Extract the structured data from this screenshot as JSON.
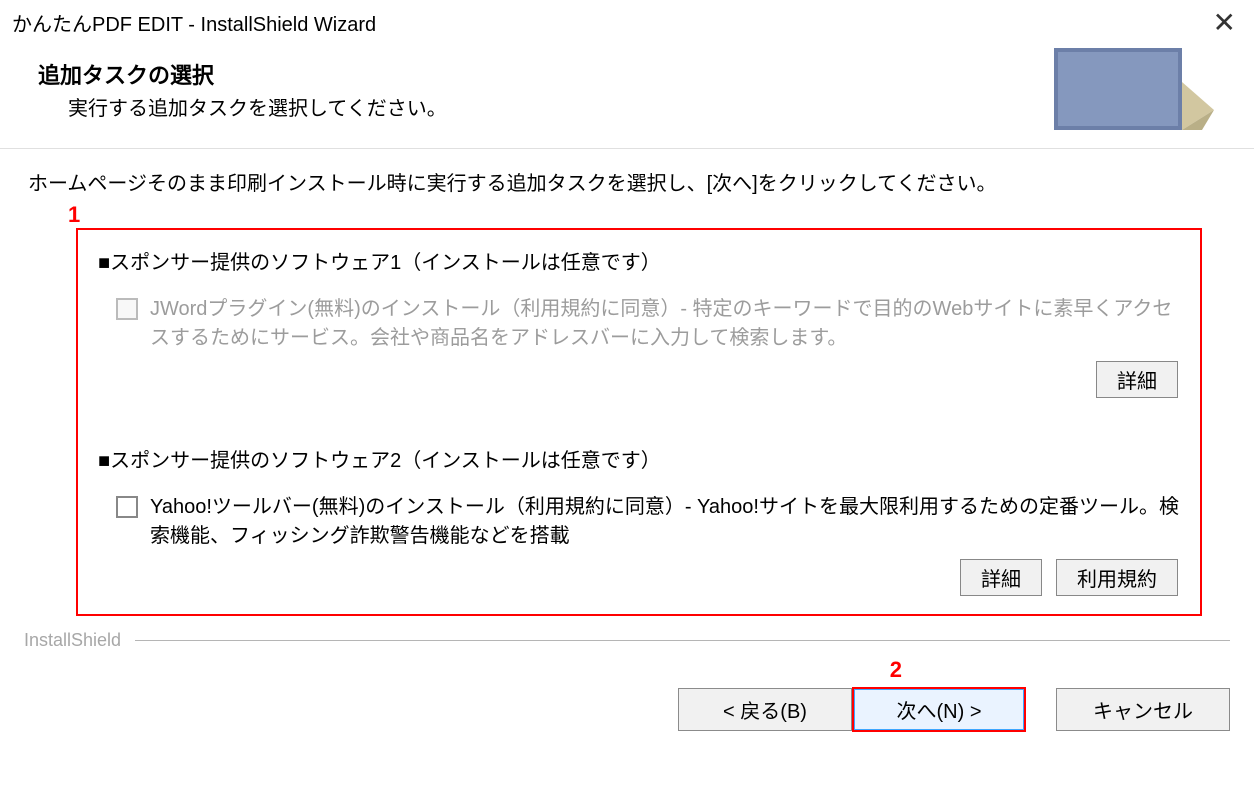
{
  "window": {
    "title": "かんたんPDF EDIT - InstallShield Wizard"
  },
  "header": {
    "title": "追加タスクの選択",
    "subtitle": "実行する追加タスクを選択してください。"
  },
  "body": {
    "description": "ホームページそのまま印刷インストール時に実行する追加タスクを選択し、[次へ]をクリックしてください。",
    "section1": {
      "title": "■スポンサー提供のソフトウェア1（インストールは任意です）",
      "option": "JWordプラグイン(無料)のインストール（利用規約に同意）- 特定のキーワードで目的のWebサイトに素早くアクセスするためにサービス。会社や商品名をアドレスバーに入力して検索します。",
      "detail_btn": "詳細"
    },
    "section2": {
      "title": "■スポンサー提供のソフトウェア2（インストールは任意です）",
      "option": "Yahoo!ツールバー(無料)のインストール（利用規約に同意）- Yahoo!サイトを最大限利用するための定番ツール。検索機能、フィッシング詐欺警告機能などを搭載",
      "detail_btn": "詳細",
      "tos_btn": "利用規約"
    }
  },
  "footer": {
    "brand": "InstallShield",
    "back": "< 戻る(B)",
    "next": "次へ(N) >",
    "cancel": "キャンセル"
  },
  "annotations": {
    "one": "1",
    "two": "2"
  }
}
